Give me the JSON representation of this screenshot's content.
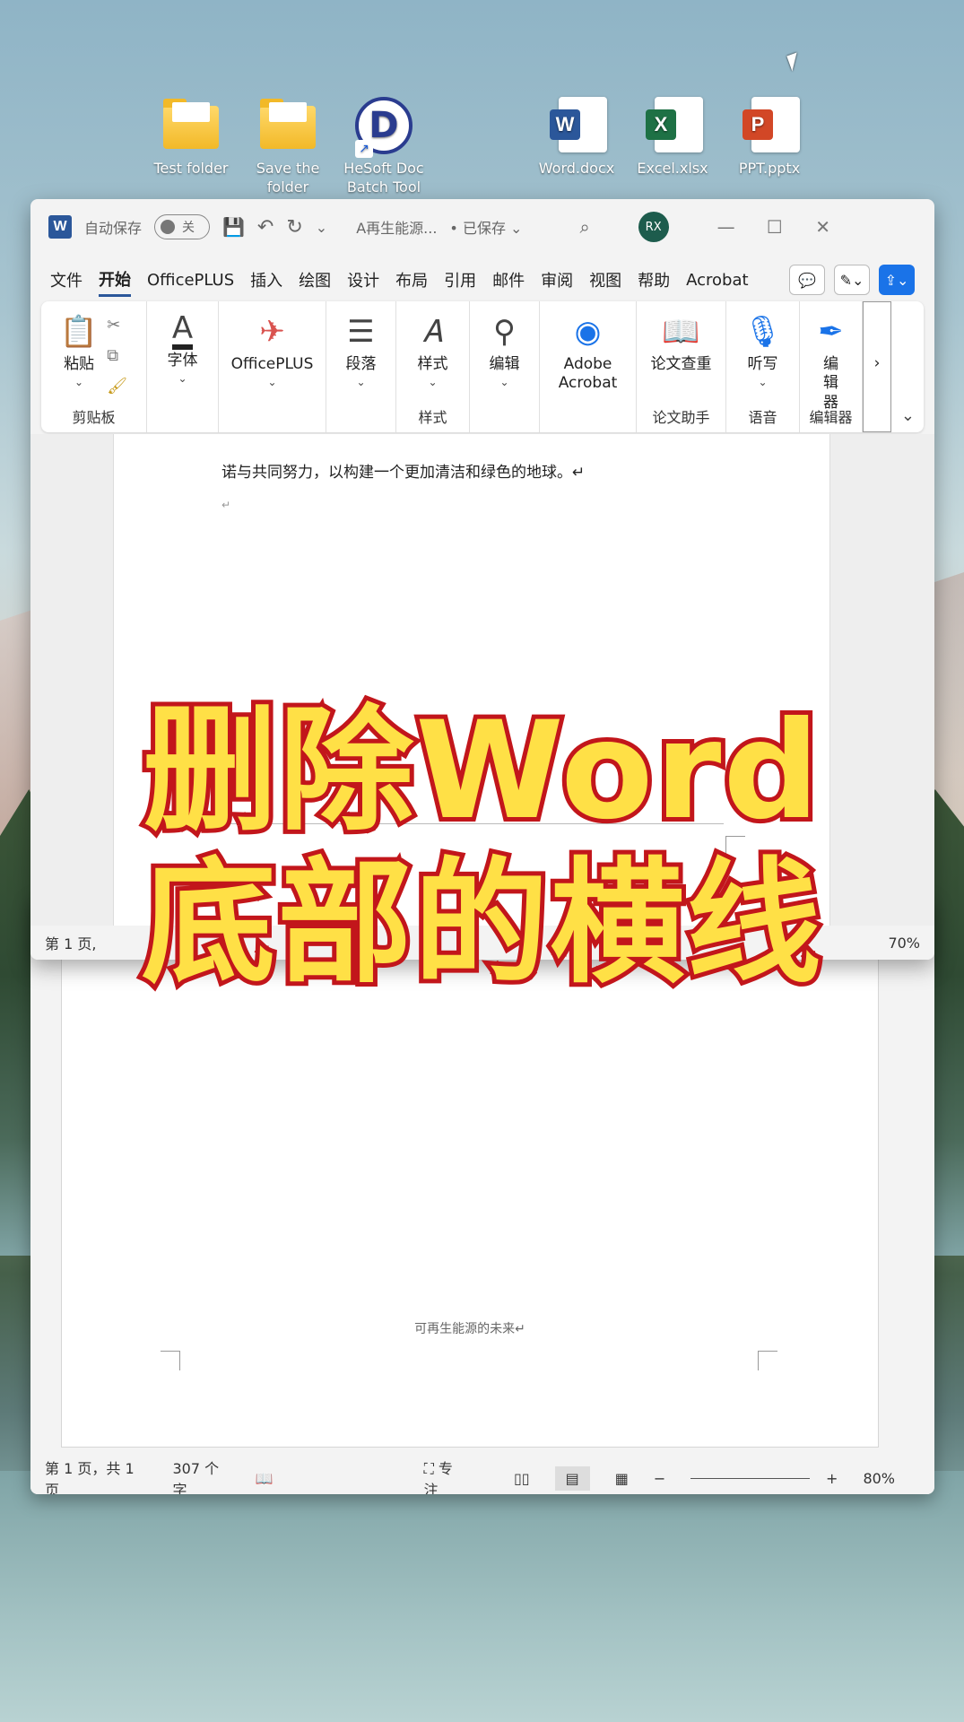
{
  "desktop": {
    "icons": [
      {
        "label": "Test folder",
        "icon": "folder-icon"
      },
      {
        "label": "Save the folder",
        "icon": "folder-icon"
      },
      {
        "label": "HeSoft Doc Batch Tool",
        "icon": "hesoft-icon",
        "glyph": "D",
        "shortcut_glyph": "↗"
      },
      {
        "label": "Word.docx",
        "icon": "word-file-icon",
        "glyph": "W",
        "color": "#2b579a"
      },
      {
        "label": "Excel.xlsx",
        "icon": "excel-file-icon",
        "glyph": "X",
        "color": "#1e7145"
      },
      {
        "label": "PPT.pptx",
        "icon": "ppt-file-icon",
        "glyph": "P",
        "color": "#d24726"
      }
    ]
  },
  "window_front": {
    "app_logo": "W",
    "autosave_label": "自动保存",
    "autosave_state": "关",
    "doc_title": "A再生能源...",
    "save_state": "• 已保存 ⌄",
    "avatar_initials": "RX",
    "menu": [
      "文件",
      "开始",
      "OfficePLUS",
      "插入",
      "绘图",
      "设计",
      "布局",
      "引用",
      "邮件",
      "审阅",
      "视图",
      "帮助",
      "Acrobat"
    ],
    "active_menu": "开始",
    "ribbon": {
      "paste": "粘贴",
      "clipboard_group": "剪贴板",
      "font": "字体",
      "officeplus": "OfficePLUS",
      "paragraph": "段落",
      "styles": "样式",
      "styles_group": "样式",
      "editing": "编辑",
      "adobe_acrobat": "Adobe Acrobat",
      "thesis_check": "论文查重",
      "thesis_group": "论文助手",
      "dictate": "听写",
      "voice_group": "语音",
      "editor": "编辑器",
      "editor_group": "编辑器"
    },
    "body_text": "诺与共同努力，以构建一个更加清洁和绿色的地球。↵",
    "para_mark": "↵",
    "status_left": "第 1 页,",
    "status_zoom": "70%"
  },
  "window_back": {
    "footer_text": "可再生能源的未来↵",
    "status": {
      "page": "第 1 页，共 1 页",
      "words": "307 个字",
      "focus": "专注",
      "zoom": "80%"
    }
  },
  "overlay": {
    "line1": "删除Word",
    "line2": "底部的横线",
    "fill_color": "#ffe046",
    "stroke_color": "#c2161b"
  }
}
